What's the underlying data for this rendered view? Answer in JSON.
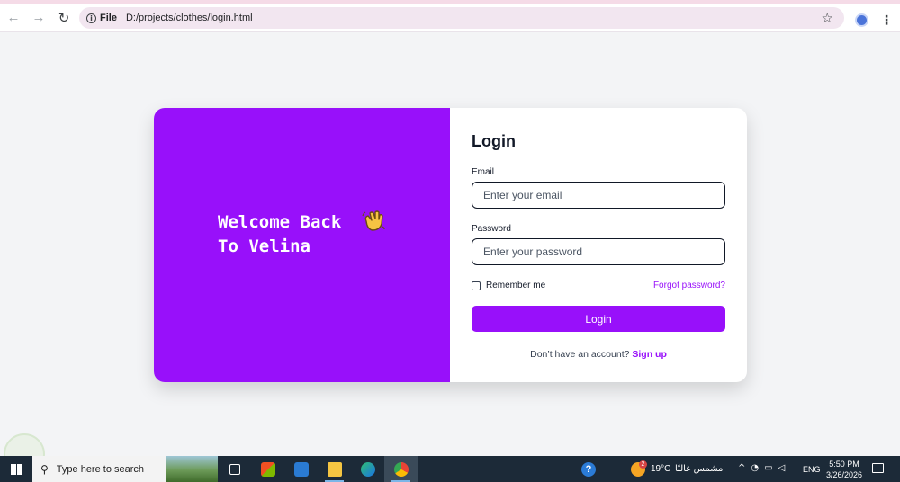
{
  "browser": {
    "scheme_label": "File",
    "url": "D:/projects/clothes/login.html"
  },
  "hero": {
    "welcome_text": "Welcome Back\nTo Velina",
    "wave_icon": "waving-hand-icon",
    "background": "#9810fa"
  },
  "form": {
    "title": "Login",
    "email_label": "Email",
    "email_placeholder": "Enter your email",
    "password_label": "Password",
    "password_placeholder": "Enter your password",
    "remember_label": "Remember me",
    "forgot_label": "Forgot password?",
    "submit_label": "Login",
    "signup_prompt": "Don’t have an account?",
    "signup_link": "Sign up",
    "accent": "#9810fa"
  },
  "taskbar": {
    "search_placeholder": "Type here to search",
    "weather_badge": "2",
    "temperature": "19°C",
    "weather_desc": "مشمس غالبًا",
    "language": "ENG",
    "time": "5:50 PM",
    "date": "3/26/2026"
  }
}
